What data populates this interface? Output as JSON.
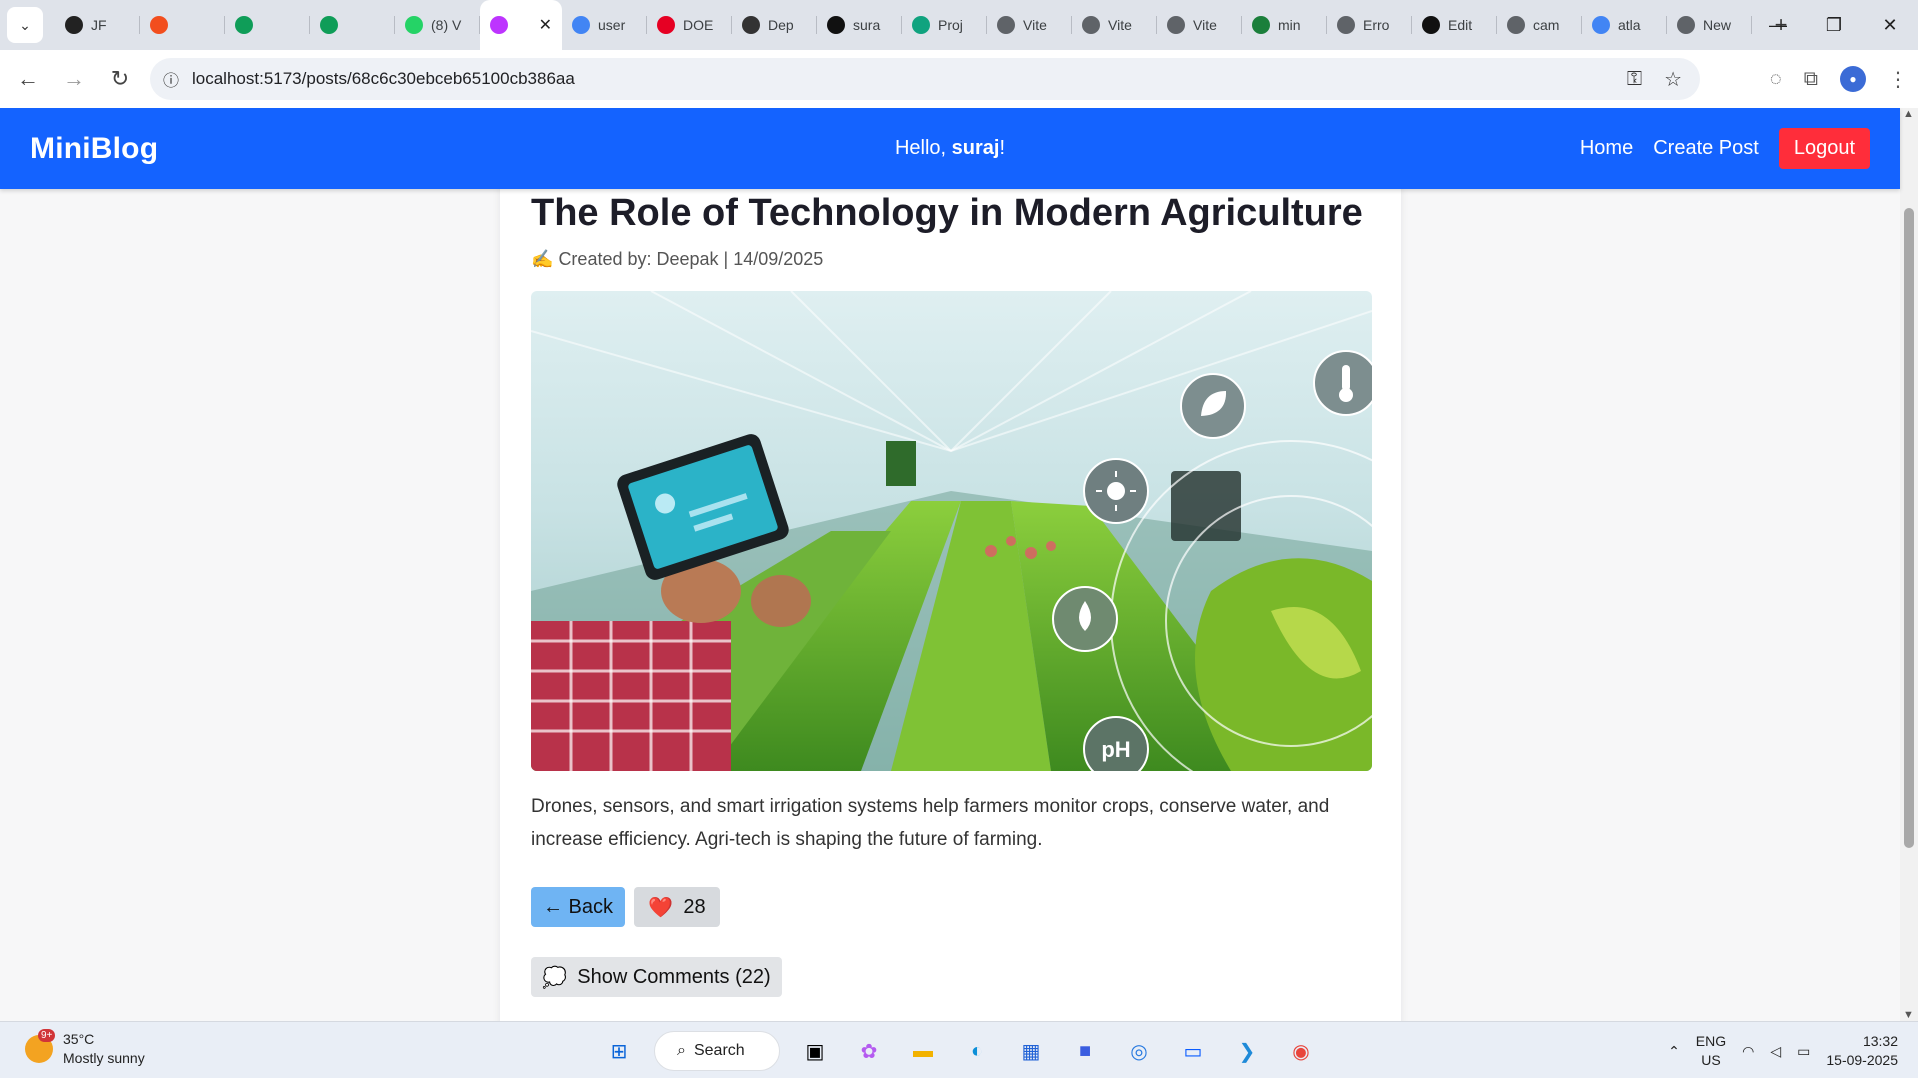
{
  "browser": {
    "tabs": [
      {
        "label": "JF",
        "icon": "jotform-icon",
        "color": "#222222"
      },
      {
        "label": "",
        "icon": "figma-icon",
        "color": "#f24e1e"
      },
      {
        "label": "",
        "icon": "sheets-icon",
        "color": "#0f9d58"
      },
      {
        "label": "",
        "icon": "sheets-icon",
        "color": "#0f9d58"
      },
      {
        "label": "(8) V",
        "icon": "whatsapp-icon",
        "color": "#25d366"
      },
      {
        "label": "",
        "icon": "vite-icon",
        "color": "#bd34fe",
        "active": true
      },
      {
        "label": "user",
        "icon": "google-icon",
        "color": "#4285f4"
      },
      {
        "label": "DOE",
        "icon": "pinterest-icon",
        "color": "#e60023"
      },
      {
        "label": "Dep",
        "icon": "openai-icon",
        "color": "#333333"
      },
      {
        "label": "sura",
        "icon": "github-icon",
        "color": "#111111"
      },
      {
        "label": "Proj",
        "icon": "diamond-icon",
        "color": "#10a37f"
      },
      {
        "label": "Vite",
        "icon": "globe-icon",
        "color": "#5f6368"
      },
      {
        "label": "Vite",
        "icon": "globe-icon",
        "color": "#5f6368"
      },
      {
        "label": "Vite",
        "icon": "globe-icon",
        "color": "#5f6368"
      },
      {
        "label": "min",
        "icon": "app-icon",
        "color": "#1b7f3b"
      },
      {
        "label": "Erro",
        "icon": "globe-icon",
        "color": "#5f6368"
      },
      {
        "label": "Edit",
        "icon": "github-icon",
        "color": "#111111"
      },
      {
        "label": "cam",
        "icon": "globe-icon",
        "color": "#5f6368"
      },
      {
        "label": "atla",
        "icon": "google-icon",
        "color": "#4285f4"
      },
      {
        "label": "New",
        "icon": "chrome-icon",
        "color": "#5f6368"
      }
    ],
    "url": "localhost:5173/posts/68c6c30ebceb65100cb386aa"
  },
  "app": {
    "brand": "MiniBlog",
    "greeting_prefix": "Hello, ",
    "user": "suraj",
    "greeting_suffix": "!",
    "nav": {
      "home": "Home",
      "create": "Create Post",
      "logout": "Logout"
    },
    "colors": {
      "appbar": "#1463ff",
      "logout": "#ff2d3a",
      "back": "#6fb4f3"
    }
  },
  "post": {
    "title": "The Role of Technology in Modern Agriculture",
    "meta_icon": "✍️",
    "meta": "Created by: Deepak | 14/09/2025",
    "image_alt": "Farmer holding a tablet in a greenhouse with smart-farming icons",
    "image_icons": [
      "leaf-icon",
      "thermometer-icon",
      "sun-icon",
      "water-drop-icon",
      "ph-icon"
    ],
    "image_ph_label": "pH",
    "body": "Drones, sensors, and smart irrigation systems help farmers monitor crops, conserve water, and increase efficiency. Agri-tech is shaping the future of farming.",
    "back_label": "← Back",
    "like_icon": "❤️",
    "likes": "28",
    "comments_icon": "💭",
    "comments_label": "Show Comments (22)"
  },
  "taskbar": {
    "weather_badge": "9+",
    "temp": "35°C",
    "condition": "Mostly sunny",
    "search": "Search",
    "lang1": "ENG",
    "lang2": "US",
    "time": "13:32",
    "date": "15-09-2025"
  }
}
